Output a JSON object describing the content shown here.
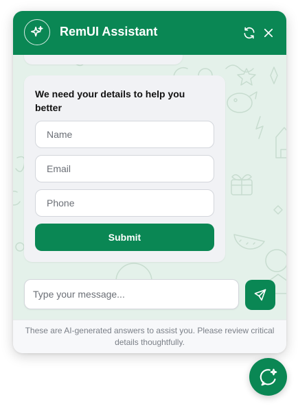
{
  "header": {
    "title": "RemUI Assistant",
    "avatar_icon": "sparkles-icon",
    "refresh_icon": "refresh-icon",
    "close_icon": "close-icon"
  },
  "form": {
    "heading": "We need your details to help you better",
    "name_placeholder": "Name",
    "email_placeholder": "Email",
    "phone_placeholder": "Phone",
    "submit_label": "Submit"
  },
  "composer": {
    "placeholder": "Type your message...",
    "send_icon": "send-icon"
  },
  "footer": {
    "disclaimer": "These are AI-generated answers to assist you. Please review critical details thoughtfully."
  },
  "launcher": {
    "icon": "chat-sparkle-icon"
  },
  "colors": {
    "brand": "#0a8754",
    "chat_background": "#e4f1ea",
    "card_background": "#f1f2f5"
  }
}
